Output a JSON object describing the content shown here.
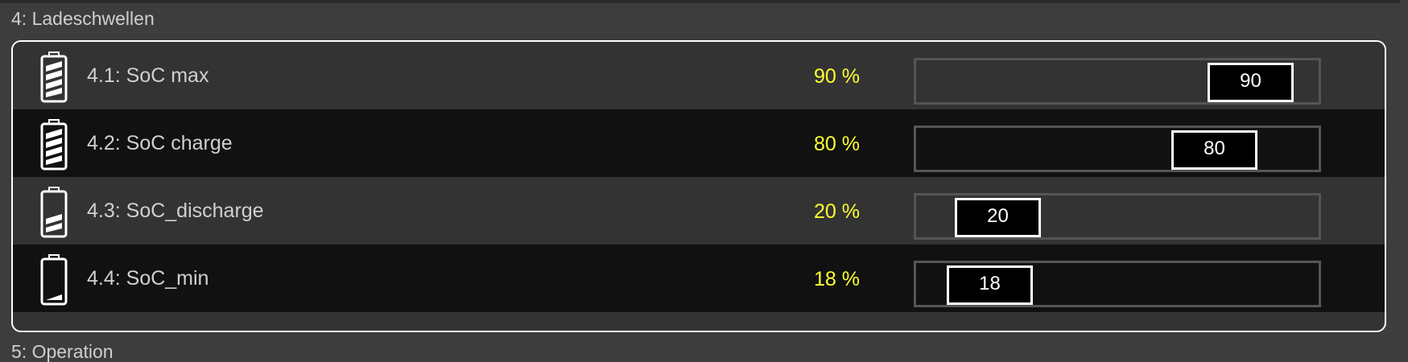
{
  "section": {
    "title": "4: Ladeschwellen",
    "next_title": "5: Operation"
  },
  "colors": {
    "value_text": "#ffff33",
    "label_text": "#d0d0d0",
    "panel_border": "#ffffff"
  },
  "rows": [
    {
      "label": "4.1: SoC max",
      "percent_text": "90 %",
      "slider_value": "90",
      "battery_icon": "battery-icon-4-bars",
      "battery_bars": 4
    },
    {
      "label": "4.2: SoC charge",
      "percent_text": "80 %",
      "slider_value": "80",
      "battery_icon": "battery-icon-4-bars",
      "battery_bars": 4
    },
    {
      "label": "4.3: SoC_discharge",
      "percent_text": "20 %",
      "slider_value": "20",
      "battery_icon": "battery-icon-2-bars",
      "battery_bars": 2
    },
    {
      "label": "4.4: SoC_min",
      "percent_text": "18 %",
      "slider_value": "18",
      "battery_icon": "battery-icon-low",
      "battery_bars": 0
    }
  ]
}
